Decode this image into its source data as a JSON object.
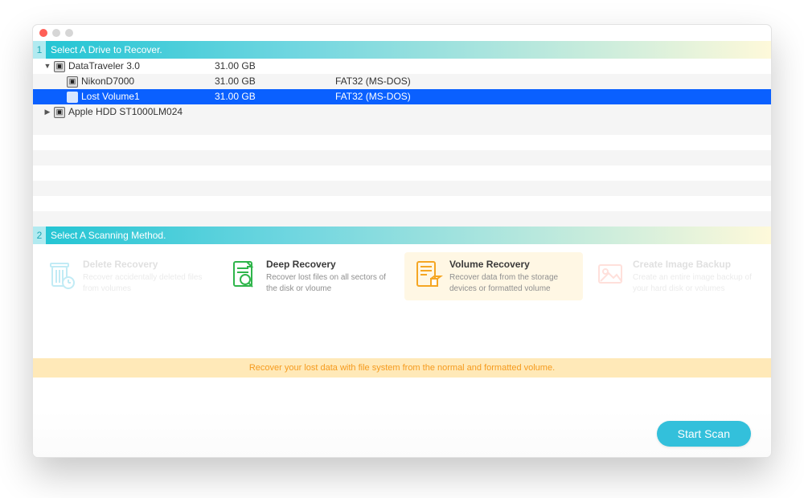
{
  "section1": {
    "num": "1",
    "title": "Select A Drive to Recover."
  },
  "drives": [
    {
      "type": "disk",
      "expanded": true,
      "name": "DataTraveler 3.0",
      "size": "31.00 GB",
      "fs": ""
    },
    {
      "type": "vol",
      "selected": false,
      "name": "NikonD7000",
      "size": "31.00 GB",
      "fs": "FAT32 (MS-DOS)"
    },
    {
      "type": "vol",
      "selected": true,
      "name": "Lost Volume1",
      "size": "31.00 GB",
      "fs": "FAT32 (MS-DOS)"
    },
    {
      "type": "disk",
      "expanded": false,
      "name": "Apple HDD ST1000LM024",
      "size": "",
      "fs": ""
    }
  ],
  "section2": {
    "num": "2",
    "title": "Select A Scanning Method."
  },
  "methods": [
    {
      "key": "delete",
      "title": "Delete Recovery",
      "desc": "Recover accidentally deleted files from volumes",
      "color": "#34c0df",
      "selected": false
    },
    {
      "key": "deep",
      "title": "Deep Recovery",
      "desc": "Recover lost files on all sectors of the disk or vloume",
      "color": "#2fb54b",
      "selected": false
    },
    {
      "key": "volume",
      "title": "Volume Recovery",
      "desc": "Recover data from the storage devices or formatted volume",
      "color": "#f5a623",
      "selected": true
    },
    {
      "key": "image",
      "title": "Create Image Backup",
      "desc": "Create an entire image backup of your hard disk or volumes",
      "color": "#ff9a8b",
      "selected": false
    }
  ],
  "hint": "Recover your lost data with file system from the normal and formatted volume.",
  "footer": {
    "start": "Start Scan"
  }
}
